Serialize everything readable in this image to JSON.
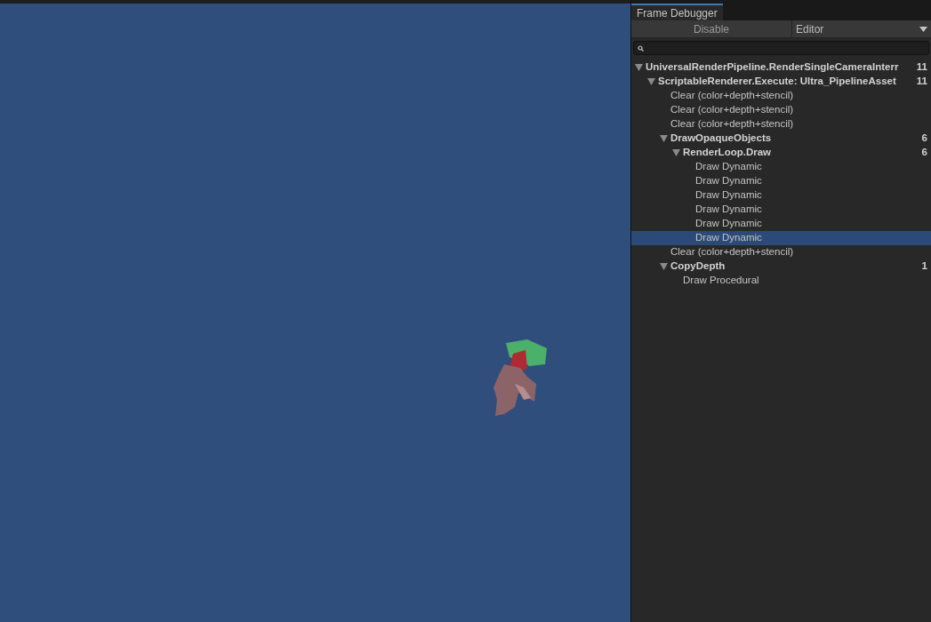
{
  "panel": {
    "tab": "Frame Debugger",
    "toolbar": {
      "button": "Disable",
      "dropdown": "Editor"
    }
  },
  "tree": [
    {
      "label": "UniversalRenderPipeline.RenderSingleCameraInterr",
      "count": "11",
      "expanded": true,
      "selected": false,
      "children": [
        {
          "label": "ScriptableRenderer.Execute: Ultra_PipelineAsset",
          "count": "11",
          "expanded": true,
          "selected": false,
          "children": [
            {
              "label": "Clear (color+depth+stencil)",
              "selected": false
            },
            {
              "label": "Clear (color+depth+stencil)",
              "selected": false
            },
            {
              "label": "Clear (color+depth+stencil)",
              "selected": false
            },
            {
              "label": "DrawOpaqueObjects",
              "count": "6",
              "expanded": true,
              "selected": false,
              "children": [
                {
                  "label": "RenderLoop.Draw",
                  "count": "6",
                  "expanded": true,
                  "selected": false,
                  "children": [
                    {
                      "label": "Draw Dynamic",
                      "selected": false
                    },
                    {
                      "label": "Draw Dynamic",
                      "selected": false
                    },
                    {
                      "label": "Draw Dynamic",
                      "selected": false
                    },
                    {
                      "label": "Draw Dynamic",
                      "selected": false
                    },
                    {
                      "label": "Draw Dynamic",
                      "selected": false
                    },
                    {
                      "label": "Draw Dynamic",
                      "selected": true
                    }
                  ]
                }
              ]
            },
            {
              "label": "Clear (color+depth+stencil)",
              "selected": false
            },
            {
              "label": "CopyDepth",
              "count": "1",
              "expanded": true,
              "selected": false,
              "children": [
                {
                  "label": "Draw Procedural",
                  "selected": false
                }
              ]
            }
          ]
        }
      ]
    }
  ]
}
